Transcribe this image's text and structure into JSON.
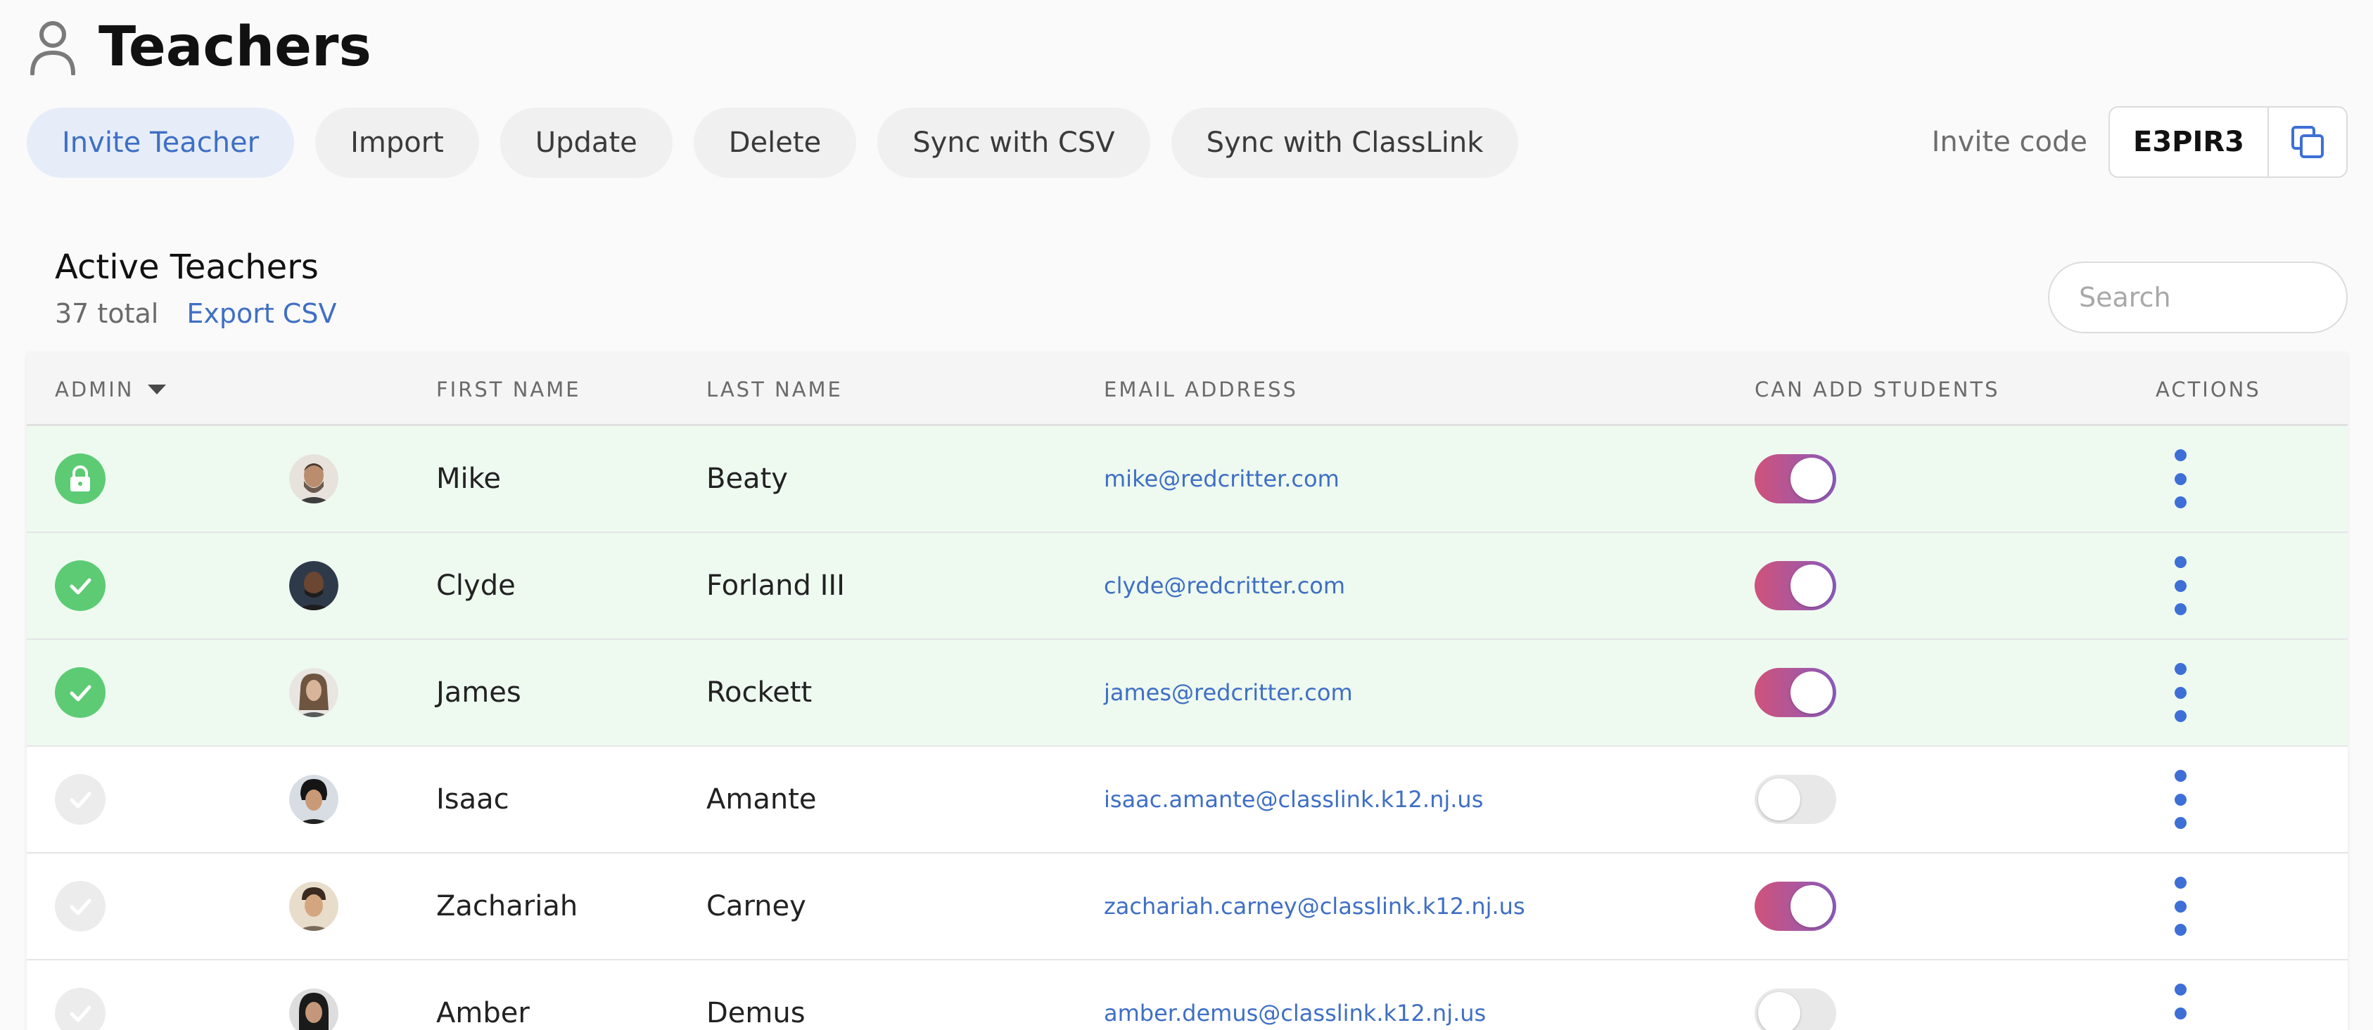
{
  "page": {
    "title": "Teachers",
    "icon": "user-icon"
  },
  "toolbar": {
    "buttons": [
      {
        "label": "Invite Teacher",
        "primary": true
      },
      {
        "label": "Import"
      },
      {
        "label": "Update"
      },
      {
        "label": "Delete"
      },
      {
        "label": "Sync with CSV"
      },
      {
        "label": "Sync with ClassLink"
      }
    ]
  },
  "invite": {
    "label": "Invite code",
    "code": "E3PIR3",
    "copy_icon": "copy-icon"
  },
  "section": {
    "title": "Active Teachers",
    "total": "37 total",
    "export_label": "Export CSV"
  },
  "search": {
    "placeholder": "Search",
    "value": ""
  },
  "table": {
    "columns": [
      "ADMIN",
      "",
      "FIRST NAME",
      "LAST NAME",
      "EMAIL ADDRESS",
      "CAN ADD STUDENTS",
      "ACTIONS"
    ],
    "rows": [
      {
        "admin": "owner",
        "first": "Mike",
        "last": "Beaty",
        "email": "mike@redcritter.com",
        "can_add": true
      },
      {
        "admin": "yes",
        "first": "Clyde",
        "last": "Forland III",
        "email": "clyde@redcritter.com",
        "can_add": true
      },
      {
        "admin": "yes",
        "first": "James",
        "last": "Rockett",
        "email": "james@redcritter.com",
        "can_add": true
      },
      {
        "admin": "no",
        "first": "Isaac",
        "last": "Amante",
        "email": "isaac.amante@classlink.k12.nj.us",
        "can_add": false
      },
      {
        "admin": "no",
        "first": "Zachariah",
        "last": "Carney",
        "email": "zachariah.carney@classlink.k12.nj.us",
        "can_add": true
      },
      {
        "admin": "no",
        "first": "Amber",
        "last": "Demus",
        "email": "amber.demus@classlink.k12.nj.us",
        "can_add": false
      }
    ]
  },
  "colors": {
    "accent": "#3f6fc4",
    "admin_green": "#5ccb74",
    "admin_row_bg": "#eefaf0",
    "toggle_start": "#d0527a",
    "toggle_end": "#8a5bbd",
    "kebab": "#3d6fd6"
  }
}
